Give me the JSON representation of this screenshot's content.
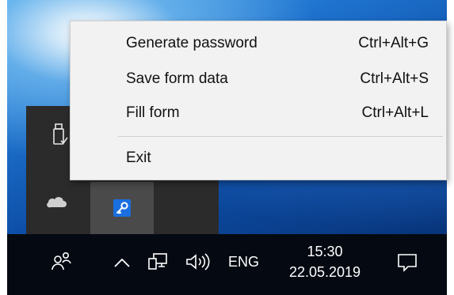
{
  "menu": {
    "items": [
      {
        "label": "Generate password",
        "shortcut": "Ctrl+Alt+G"
      },
      {
        "label": "Save form data",
        "shortcut": "Ctrl+Alt+S"
      },
      {
        "label": "Fill form",
        "shortcut": "Ctrl+Alt+L"
      }
    ],
    "exit_label": "Exit"
  },
  "tray_overflow": {
    "icons": [
      "usb-drive-icon",
      "onedrive-cloud-icon",
      "password-manager-key-icon"
    ]
  },
  "taskbar": {
    "language": "ENG",
    "time": "15:30",
    "date": "22.05.2019",
    "icons": [
      "people-icon",
      "chevron-up-icon",
      "network-icon",
      "volume-icon",
      "action-center-icon"
    ]
  },
  "colors": {
    "menu_background": "#f2f2f2",
    "taskbar_background": "#050a12",
    "tray_overflow_background": "#2b2b2b",
    "accent": "#1a6fe0"
  }
}
